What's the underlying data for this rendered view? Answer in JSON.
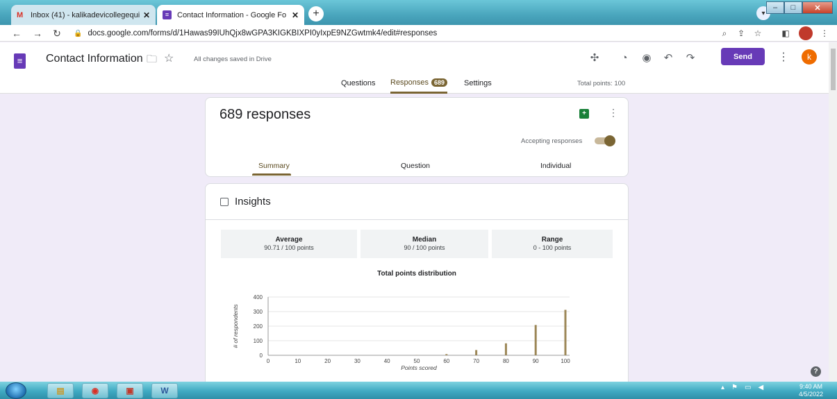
{
  "browser": {
    "tabs": [
      {
        "label": "Inbox (41) - kalikadevicollegequi",
        "icon": "gmail-icon"
      },
      {
        "label": "Contact Information - Google Fo",
        "icon": "forms-icon"
      }
    ],
    "url": "docs.google.com/forms/d/1Hawas99IUhQjx8wGPA3KIGKBIXPI0yIxpE9NZGwtmk4/edit#responses"
  },
  "form": {
    "title": "Contact Information",
    "save_status": "All changes saved in Drive",
    "send_label": "Send",
    "avatar_letter": "k",
    "tabs": {
      "questions": "Questions",
      "responses": "Responses",
      "responses_count": "689",
      "settings": "Settings"
    },
    "total_points": "Total points: 100"
  },
  "responses": {
    "count_label": "689 responses",
    "accepting_label": "Accepting responses",
    "accepting": true,
    "subtabs": {
      "summary": "Summary",
      "question": "Question",
      "individual": "Individual"
    }
  },
  "insights": {
    "title": "Insights",
    "stats": [
      {
        "label": "Average",
        "value": "90.71 / 100 points"
      },
      {
        "label": "Median",
        "value": "90 / 100 points"
      },
      {
        "label": "Range",
        "value": "0 - 100 points"
      }
    ]
  },
  "chart_data": {
    "type": "bar",
    "title": "Total points distribution",
    "xlabel": "Points scored",
    "ylabel": "# of respondents",
    "x": [
      0,
      10,
      20,
      30,
      40,
      50,
      60,
      70,
      80,
      90,
      100
    ],
    "values": [
      0,
      0,
      0,
      0,
      0,
      1,
      8,
      36,
      82,
      208,
      312
    ],
    "xticks": [
      "0",
      "10",
      "20",
      "30",
      "40",
      "50",
      "60",
      "70",
      "80",
      "90",
      "100"
    ],
    "yticks": [
      "0",
      "100",
      "200",
      "300",
      "400"
    ],
    "ylim": [
      0,
      400
    ],
    "xlim": [
      0,
      100
    ],
    "bar_color": "#9c8757",
    "grid": true
  },
  "system": {
    "time": "9:40 AM",
    "date": "4/5/2022"
  },
  "colors": {
    "accent": "#673ab7",
    "theme": "#7a6533",
    "background": "#f0ebf8"
  }
}
